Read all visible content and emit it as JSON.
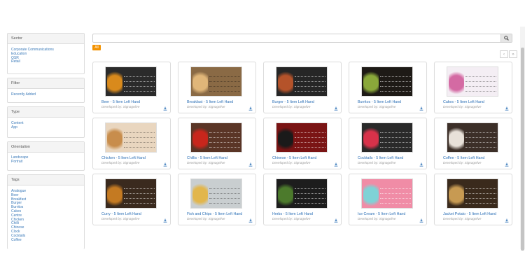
{
  "sidebar": {
    "sector": {
      "title": "Sector",
      "items": [
        "Corporate Communications",
        "Education",
        "QSR",
        "Retail"
      ]
    },
    "filter": {
      "title": "Filter",
      "items": [
        "Recently Added"
      ]
    },
    "type": {
      "title": "Type",
      "items": [
        "Content",
        "App"
      ]
    },
    "orientation": {
      "title": "Orientation",
      "items": [
        "Landscape",
        "Portrait"
      ]
    },
    "tags": {
      "title": "Tags",
      "items": [
        "Analogue",
        "Beer",
        "Breakfast",
        "Burger",
        "Burritos",
        "Cakes",
        "Centre",
        "Chicken",
        "Chilli",
        "Chinese",
        "Clock",
        "Cocktails",
        "Coffee"
      ]
    }
  },
  "search": {
    "placeholder": "",
    "value": ""
  },
  "filter_all_label": "All",
  "pager": {
    "prev": "‹",
    "next": "»"
  },
  "colors": {
    "accent": "#f39200",
    "link": "#2a6eb5"
  },
  "cards": [
    {
      "title": "Beer - 5 Item Left Hand",
      "developer": "Developed by: Signagelive",
      "bg": "#2b2b2b",
      "food": "#d98a1c",
      "light": false
    },
    {
      "title": "Breakfast - 5 Item Left Hand",
      "developer": "Developed by: Signagelive",
      "bg": "#8a6a45",
      "food": "#e0b679",
      "light": true
    },
    {
      "title": "Burger - 5 Item Left Hand",
      "developer": "Developed by: Signagelive",
      "bg": "#262626",
      "food": "#b5532a",
      "light": false
    },
    {
      "title": "Burritos - 5 Item Left Hand",
      "developer": "Developed by: Signagelive",
      "bg": "#1e1a16",
      "food": "#8aa83a",
      "light": false
    },
    {
      "title": "Cakes - 5 Item Left Hand",
      "developer": "Developed by: Signagelive",
      "bg": "#f4eef4",
      "food": "#d46aa3",
      "light": true
    },
    {
      "title": "Chicken - 5 Item Left Hand",
      "developer": "Developed by: Signagelive",
      "bg": "#e9d6bf",
      "food": "#c88d4c",
      "light": true
    },
    {
      "title": "Chillis - 5 Item Left Hand",
      "developer": "Developed by: Signagelive",
      "bg": "#5a3526",
      "food": "#c8261c",
      "light": false
    },
    {
      "title": "Chinese - 5 Item Left Hand",
      "developer": "Developed by: Signagelive",
      "bg": "#7a1414",
      "food": "#1a1a1a",
      "light": false
    },
    {
      "title": "Cocktails - 5 Item Left Hand",
      "developer": "Developed by: Signagelive",
      "bg": "#2a2a2a",
      "food": "#d8324a",
      "light": false
    },
    {
      "title": "Coffee - 5 Item Left Hand",
      "developer": "Developed by: Signagelive",
      "bg": "#3c2f28",
      "food": "#e8e1d9",
      "light": false
    },
    {
      "title": "Curry - 5 Item Left Hand",
      "developer": "Developed by: Signagelive",
      "bg": "#3a2a1e",
      "food": "#c47a22",
      "light": false
    },
    {
      "title": "Fish and Chips - 5 Item Left Hand",
      "developer": "Developed by: Signagelive",
      "bg": "#c9ced0",
      "food": "#e2b64c",
      "light": true
    },
    {
      "title": "Herbs - 5 Item Left Hand",
      "developer": "Developed by: Signagelive",
      "bg": "#1d1d1d",
      "food": "#4c7a2c",
      "light": false
    },
    {
      "title": "Ice Cream - 5 Item Left Hand",
      "developer": "Developed by: Signagelive",
      "bg": "#f08ca6",
      "food": "#7fd2d6",
      "light": false
    },
    {
      "title": "Jacket Potato - 5 Item Left Hand",
      "developer": "Developed by: Signagelive",
      "bg": "#3a2a1c",
      "food": "#c79a52",
      "light": false
    }
  ]
}
